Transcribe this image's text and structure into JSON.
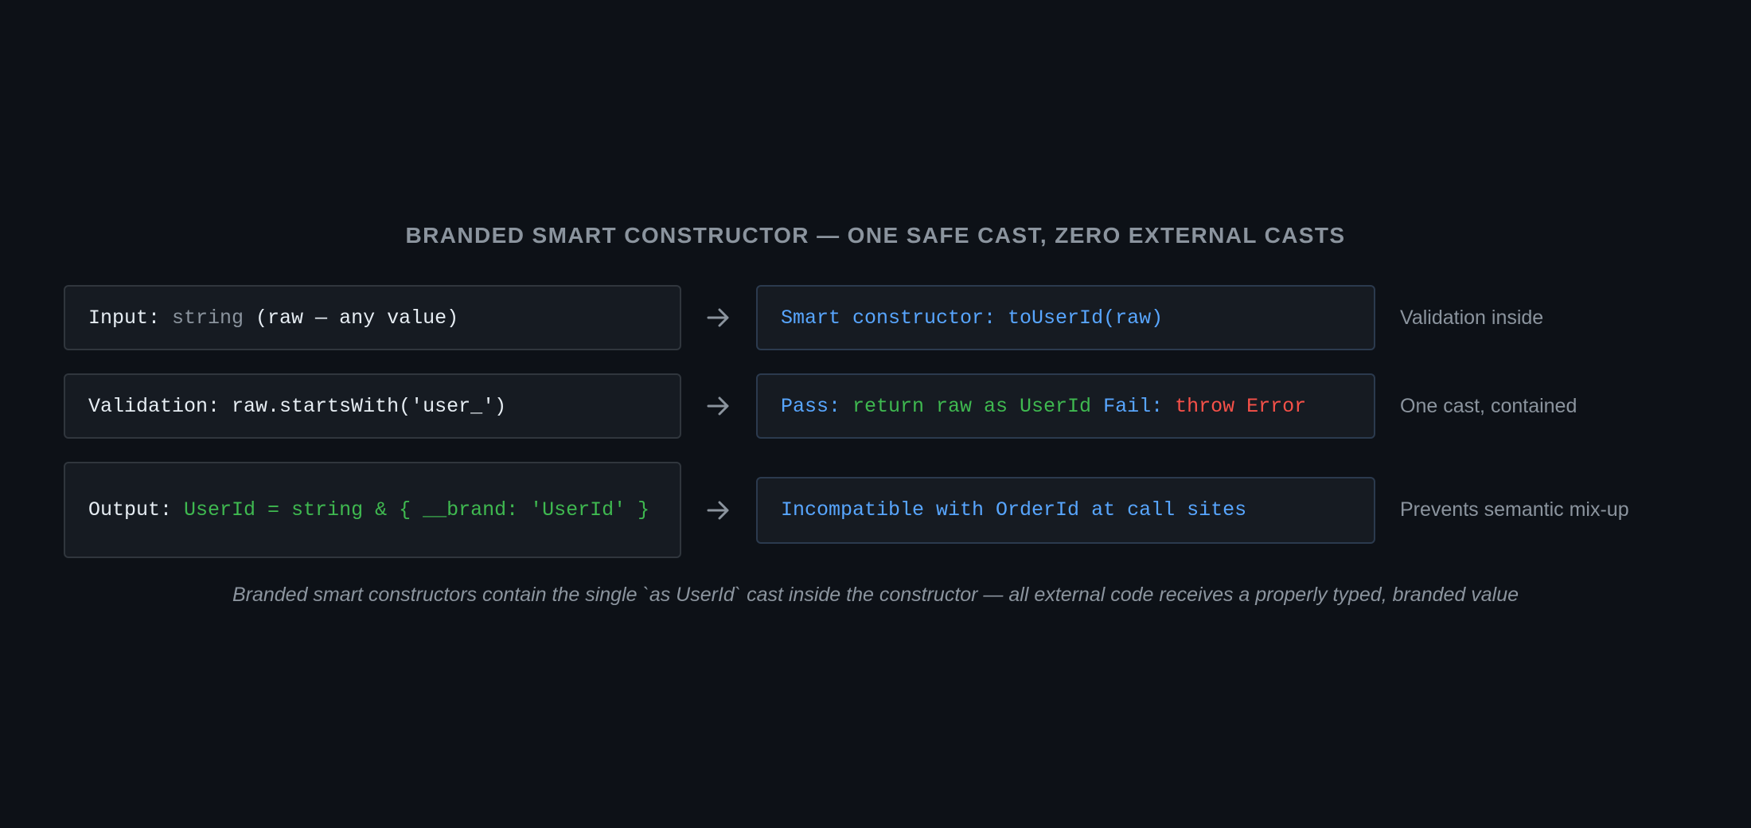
{
  "title": "BRANDED SMART CONSTRUCTOR — ONE SAFE CAST, ZERO EXTERNAL CASTS",
  "rows": [
    {
      "left": {
        "label": "Input: ",
        "type": "string",
        "rest": " (raw — any value)"
      },
      "right": {
        "text": "Smart constructor: toUserId(raw)"
      },
      "note": "Validation inside"
    },
    {
      "left": {
        "label": "Validation: ",
        "code": "raw.startsWith('user_')"
      },
      "right": {
        "pass_label": "Pass: ",
        "pass_code": "return raw as UserId",
        "fail_label": " Fail: ",
        "fail_code": "throw Error"
      },
      "note": "One cast, contained"
    },
    {
      "left": {
        "label": "Output: ",
        "type": "UserId = string & { __brand: 'UserId' }"
      },
      "right": {
        "text": "Incompatible with OrderId at call sites"
      },
      "note": "Prevents semantic mix-up"
    }
  ],
  "arrow_icon": "right-arrow-icon",
  "caption": "Branded smart constructors contain the single `as UserId` cast inside the constructor — all external code receives a properly typed, branded value",
  "colors": {
    "background": "#0d1117",
    "box": "#161b22",
    "border": "#30363d",
    "text": "#e6edf3",
    "muted": "#8b949e",
    "blue": "#58a6ff",
    "green": "#3fb950",
    "red": "#f85149"
  }
}
